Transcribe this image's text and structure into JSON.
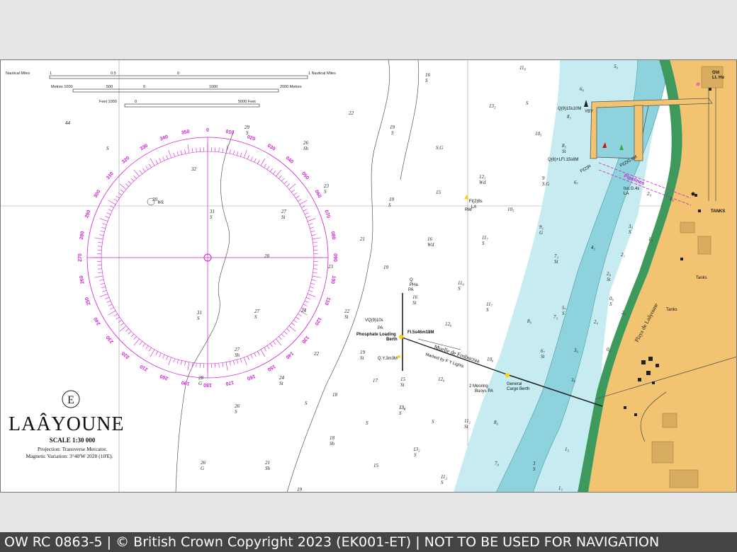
{
  "footer": {
    "text": "OW RC 0863-5 | © British Crown Copyright 2023 (EK001-ET) | NOT TO BE USED FOR NAVIGATION"
  },
  "title_block": {
    "emblem": "E",
    "name": "LAÂYOUNE",
    "scale": "SCALE 1:30 000",
    "projection": "Projection: Transverse Mercator.",
    "variation": "Magnetic Variation: 3°40'W 2020 (10'E)."
  },
  "scale_bars": {
    "nautical_miles_label": "Nautical Miles",
    "nautical_miles_end": "1 Nautical Miles",
    "nm_ticks": [
      "1",
      "0.5",
      "0"
    ],
    "metres_label": "Metres 1000",
    "metres_end": "2000 Metres",
    "metres_ticks": [
      "500",
      "0",
      "1000"
    ],
    "feet_label": "Feet 1000",
    "feet_end": "5000 Feet",
    "feet_ticks": [
      "0"
    ]
  },
  "compass": {
    "labels": [
      "0",
      "010",
      "020",
      "030",
      "040",
      "050",
      "060",
      "070",
      "080",
      "090",
      "100",
      "110",
      "120",
      "130",
      "140",
      "150",
      "160",
      "170",
      "180",
      "190",
      "200",
      "210",
      "220",
      "230",
      "240",
      "250",
      "260",
      "270",
      "280",
      "290",
      "300",
      "310",
      "320",
      "330",
      "340",
      "350"
    ],
    "center_depth": "28"
  },
  "landmarks": {
    "old_lt_ho": [
      "Old",
      "Lt. Ho"
    ],
    "tanks": [
      "TANKS",
      "Tanks",
      "Tanks"
    ],
    "phosphate_berth": [
      "Phosphate Loading",
      "Berth"
    ],
    "general_cargo": [
      "General",
      "Cargo Berth"
    ],
    "mooring": [
      "2 Mooring",
      "Buoys PA"
    ],
    "muelle": "Muelle de Fosbucraa",
    "marked_by": "Marked by F Y Lights",
    "playa": "Playa de Laâyoune",
    "pipelines": "Pipelines",
    "wk": "Wk"
  },
  "lights": {
    "q9": "Q(9)15s10M",
    "q6": "Q(6)+LFl.15s8M",
    "fl2r": "Fl(2)R",
    "fl2g": "Fl(2)G.6M",
    "iso": "Iso.G.4s",
    "fl2_8s": "Fl(2)8s",
    "vq9": "VQ(9)10s",
    "fl5s": "Fl.5s46m18M",
    "qy": "Q.Y.3m3M",
    "q": "Q",
    "pha": "PHa",
    "pa": "PA",
    "la": "LA",
    "rw": "RW",
    "yby": "YBY"
  },
  "soundings": [
    {
      "v": "44"
    },
    {
      "v": "S"
    },
    {
      "v": "29"
    },
    {
      "v": "S"
    },
    {
      "v": "26"
    },
    {
      "v": "Sh"
    },
    {
      "v": "22"
    },
    {
      "v": "19"
    },
    {
      "v": "S"
    },
    {
      "v": "16"
    },
    {
      "v": "S"
    },
    {
      "v": "S.G"
    },
    {
      "v": "13₂"
    },
    {
      "v": "S"
    },
    {
      "v": "11₈"
    },
    {
      "v": "10₅"
    },
    {
      "v": "32"
    },
    {
      "v": "20"
    },
    {
      "v": "23"
    },
    {
      "v": "S"
    },
    {
      "v": "19"
    },
    {
      "v": "S"
    },
    {
      "v": "15"
    },
    {
      "v": "12₁"
    },
    {
      "v": "Wd"
    },
    {
      "v": "10₅"
    },
    {
      "v": "31"
    },
    {
      "v": "S"
    },
    {
      "v": "27"
    },
    {
      "v": "St"
    },
    {
      "v": "21"
    },
    {
      "v": "16"
    },
    {
      "v": "Wd"
    },
    {
      "v": "11₇"
    },
    {
      "v": "S"
    },
    {
      "v": "23"
    },
    {
      "v": "19"
    },
    {
      "v": "11₆"
    },
    {
      "v": "S"
    },
    {
      "v": "31"
    },
    {
      "v": "S"
    },
    {
      "v": "27"
    },
    {
      "v": "S"
    },
    {
      "v": "24"
    },
    {
      "v": "22"
    },
    {
      "v": "St"
    },
    {
      "v": "16"
    },
    {
      "v": "St"
    },
    {
      "v": "11₇"
    },
    {
      "v": "S"
    },
    {
      "v": "12₆"
    },
    {
      "v": "27"
    },
    {
      "v": "Sh"
    },
    {
      "v": "22"
    },
    {
      "v": "19"
    },
    {
      "v": "St"
    },
    {
      "v": "13₆"
    },
    {
      "v": "S"
    },
    {
      "v": "10₆"
    },
    {
      "v": "17"
    },
    {
      "v": "15"
    },
    {
      "v": "St"
    },
    {
      "v": "12₈"
    },
    {
      "v": "28"
    },
    {
      "v": "G"
    },
    {
      "v": "24"
    },
    {
      "v": "St"
    },
    {
      "v": "18"
    },
    {
      "v": "13₈"
    },
    {
      "v": "26"
    },
    {
      "v": "S"
    },
    {
      "v": "S"
    },
    {
      "v": "S"
    },
    {
      "v": "S"
    },
    {
      "v": "11₂"
    },
    {
      "v": "St"
    },
    {
      "v": "8₆"
    },
    {
      "v": "18"
    },
    {
      "v": "Sh"
    },
    {
      "v": "13₂"
    },
    {
      "v": "S"
    },
    {
      "v": "26"
    },
    {
      "v": "G"
    },
    {
      "v": "21"
    },
    {
      "v": "Sh"
    },
    {
      "v": "15"
    },
    {
      "v": "11₂"
    },
    {
      "v": "S"
    },
    {
      "v": "7₈"
    },
    {
      "v": "19"
    },
    {
      "v": "9₁"
    },
    {
      "v": "G"
    },
    {
      "v": "7₃"
    },
    {
      "v": "St"
    },
    {
      "v": "5₇"
    },
    {
      "v": "S"
    },
    {
      "v": "8₉"
    },
    {
      "v": "6₇"
    },
    {
      "v": "St"
    },
    {
      "v": "3₆"
    },
    {
      "v": "0₆"
    },
    {
      "v": "4₂"
    },
    {
      "v": "2₈"
    },
    {
      "v": "St"
    },
    {
      "v": "0₉"
    },
    {
      "v": "S"
    },
    {
      "v": "2₄"
    },
    {
      "v": "3₈"
    },
    {
      "v": "5₉"
    },
    {
      "v": "6₉"
    },
    {
      "v": "8₁"
    },
    {
      "v": "8₅"
    },
    {
      "v": "St"
    },
    {
      "v": "9"
    },
    {
      "v": "S.G"
    },
    {
      "v": "6₇"
    },
    {
      "v": "2₉"
    },
    {
      "v": "1₆"
    },
    {
      "v": "3₅"
    },
    {
      "v": "S"
    },
    {
      "v": "1₃"
    },
    {
      "v": "2₁"
    },
    {
      "v": "7₃"
    },
    {
      "v": "2₁"
    },
    {
      "v": "3"
    },
    {
      "v": "S"
    },
    {
      "v": "1₅"
    },
    {
      "v": "1₃"
    }
  ],
  "colors": {
    "land": "#f2c472",
    "shallow_water": "#c6ecf2",
    "intertidal": "#8ed2de",
    "beach": "#3e9a5c",
    "magenta": "#d020d0",
    "footer_bg": "#444444"
  }
}
